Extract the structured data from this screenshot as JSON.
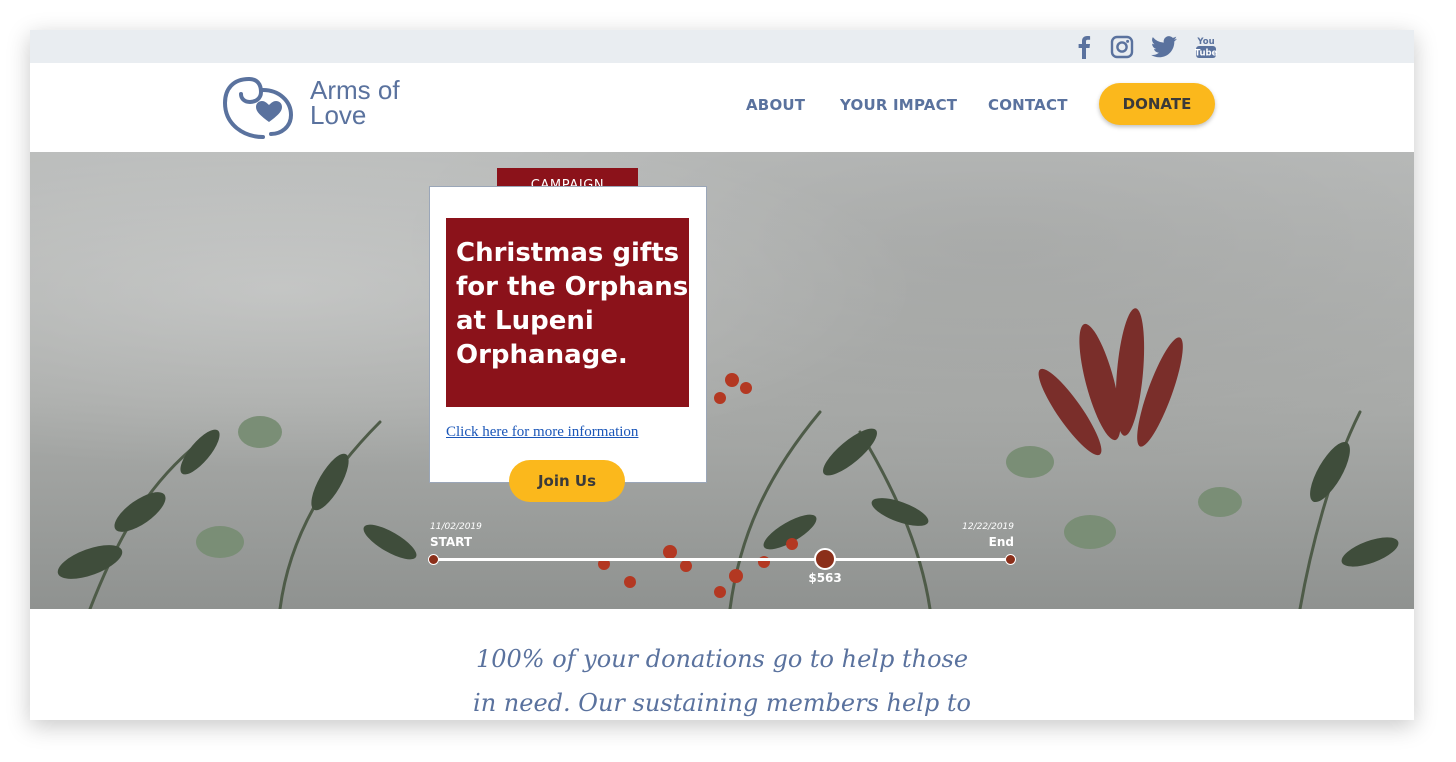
{
  "social": [
    "facebook-icon",
    "instagram-icon",
    "twitter-icon",
    "youtube-icon"
  ],
  "brand": {
    "line1": "Arms of",
    "line2": "Love"
  },
  "nav": {
    "about": "ABOUT",
    "impact": "YOUR IMPACT",
    "contact": "CONTACT",
    "donate": "DONATE"
  },
  "campaign": {
    "tag": "CAMPAIGN",
    "title": "Christmas gifts for the Orphans at Lupeni Orphanage.",
    "link": "Click here for more information",
    "join": "Join Us"
  },
  "progress": {
    "start_date": "11/02/2019",
    "start_label": "START",
    "end_date": "12/22/2019",
    "end_label": "End",
    "amount": "$563",
    "fraction": 0.68
  },
  "tagline": {
    "line1": "100% of your donations go to help those",
    "line2": "in need. Our sustaining members help to"
  },
  "colors": {
    "brand": "#5a729e",
    "accent": "#fbb81c",
    "campaign": "#8b121a"
  }
}
